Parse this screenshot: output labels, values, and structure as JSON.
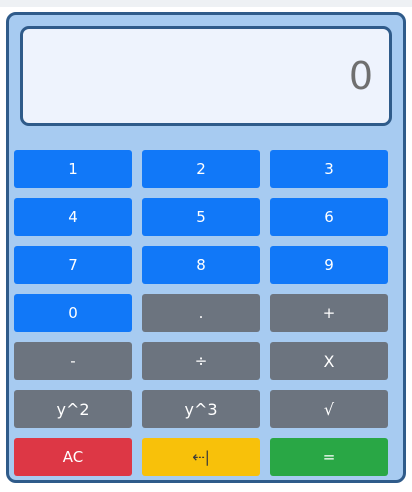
{
  "display": {
    "value": "0"
  },
  "keys": {
    "one": "1",
    "two": "2",
    "three": "3",
    "four": "4",
    "five": "5",
    "six": "6",
    "seven": "7",
    "eight": "8",
    "nine": "9",
    "zero": "0",
    "decimal": ".",
    "plus": "+",
    "minus": "-",
    "divide": "÷",
    "multiply": "X",
    "square": "y^2",
    "cube": "y^3",
    "sqrt": "√",
    "clear": "AC",
    "backspace": "⇠|",
    "equals": "="
  },
  "colors": {
    "digit": "#1178f8",
    "operator": "#6c747f",
    "clear": "#dd3745",
    "backspace": "#f8c10a",
    "equals": "#29a745",
    "panel": "#a7cbf1",
    "border": "#2f5b8a",
    "display_bg": "#eef3fd"
  }
}
